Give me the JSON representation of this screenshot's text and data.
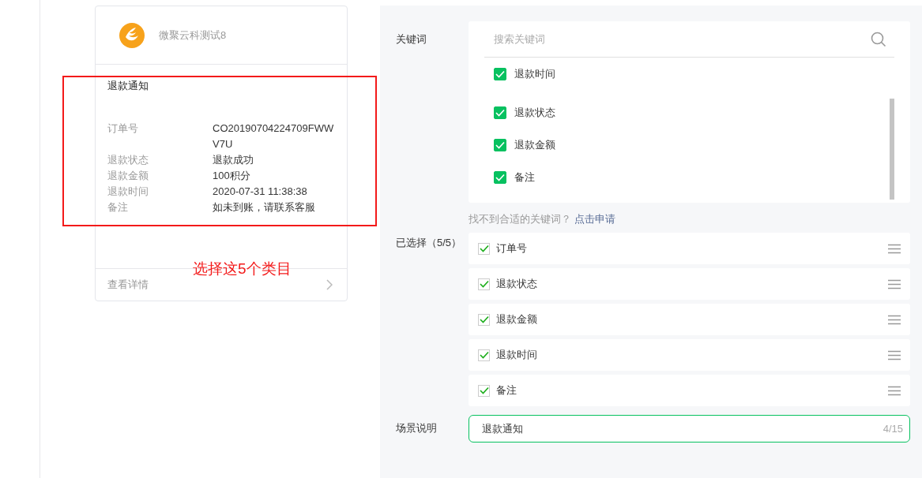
{
  "preview_card": {
    "account_name": "微聚云科测试8",
    "title": "退款通知",
    "fields": [
      {
        "label": "订单号",
        "value": "CO20190704224709FWWV7U"
      },
      {
        "label": "退款状态",
        "value": "退款成功"
      },
      {
        "label": "退款金额",
        "value": "100积分"
      },
      {
        "label": "退款时间",
        "value": "2020-07-31 11:38:38"
      },
      {
        "label": "备注",
        "value": "如未到账，请联系客服"
      }
    ],
    "footer_link": "查看详情"
  },
  "annotation": {
    "text": "选择这5个类目"
  },
  "keywords": {
    "label": "关键词",
    "search": {
      "placeholder": "搜索关键词"
    },
    "options": [
      {
        "label": "退款时间",
        "checked": true
      },
      {
        "label": "退款状态",
        "checked": true
      },
      {
        "label": "退款金额",
        "checked": true
      },
      {
        "label": "备注",
        "checked": true
      }
    ],
    "hint": "找不到合适的关键词？",
    "apply_link": "点击申请"
  },
  "selected": {
    "label": "已选择（5/5）",
    "items": [
      {
        "label": "订单号",
        "checked": true
      },
      {
        "label": "退款状态",
        "checked": true
      },
      {
        "label": "退款金额",
        "checked": true
      },
      {
        "label": "退款时间",
        "checked": true
      },
      {
        "label": "备注",
        "checked": true
      }
    ]
  },
  "scene": {
    "label": "场景说明",
    "value": "退款通知",
    "counter": "4/15"
  }
}
